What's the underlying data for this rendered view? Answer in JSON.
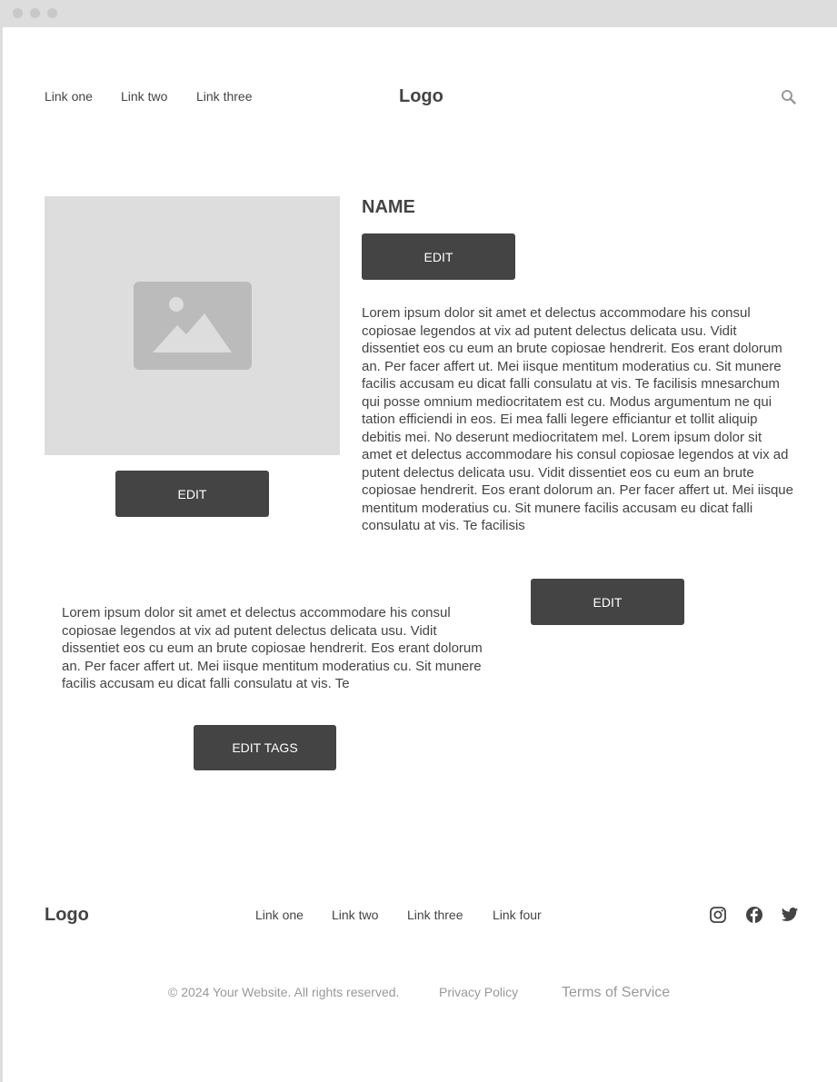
{
  "header": {
    "nav_links": [
      "Link one",
      "Link two",
      "Link three"
    ],
    "logo": "Logo",
    "search_icon": "search-icon"
  },
  "profile": {
    "image_icon": "image-placeholder-icon",
    "image_edit_label": "EDIT",
    "name": "NAME",
    "name_edit_label": "EDIT",
    "bio": "Lorem ipsum dolor sit amet et delectus accommodare his consul copiosae legendos at vix ad putent delectus delicata usu. Vidit dissentiet eos cu eum an brute copiosae hendrerit. Eos erant dolorum an. Per facer affert ut. Mei iisque mentitum moderatius cu. Sit munere facilis accusam eu dicat falli consulatu at vis. Te facilisis mnesarchum qui posse omnium mediocritatem est cu. Modus argumentum ne qui tation efficiendi in eos. Ei mea falli legere efficiantur et tollit aliquip debitis mei. No deserunt mediocritatem mel. Lorem ipsum dolor sit amet et delectus accommodare his consul copiosae legendos at vix ad putent delectus delicata usu. Vidit dissentiet eos cu eum an brute copiosae hendrerit. Eos erant dolorum an. Per facer affert ut. Mei iisque mentitum moderatius cu. Sit munere facilis accusam eu dicat falli consulatu at vis. Te facilisis",
    "bio_edit_label": "EDIT",
    "tags_text": "Lorem ipsum dolor sit amet et delectus accommodare his consul copiosae legendos at vix ad putent delectus delicata usu. Vidit dissentiet eos cu eum an brute copiosae hendrerit. Eos erant dolorum an. Per facer affert ut. Mei iisque mentitum moderatius cu. Sit munere facilis accusam eu dicat falli consulatu at vis. Te",
    "edit_tags_label": "EDIT TAGS"
  },
  "footer": {
    "logo": "Logo",
    "links": [
      "Link one",
      "Link two",
      "Link three",
      "Link four"
    ],
    "social_icons": [
      "instagram-icon",
      "facebook-icon",
      "twitter-icon"
    ],
    "copyright": "© 2024 Your Website. All rights reserved.",
    "privacy": "Privacy Policy",
    "terms": "Terms of Service"
  },
  "colors": {
    "button_bg": "#444444",
    "placeholder_bg": "#dddddd",
    "text": "#444444",
    "muted_text": "#999999"
  }
}
